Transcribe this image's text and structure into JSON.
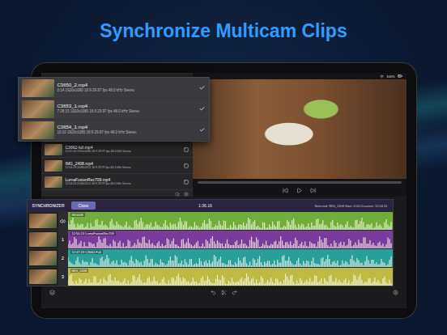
{
  "headline": "Synchronize Multicam Clips",
  "status_bar": {
    "battery": "100%"
  },
  "popup_clips": [
    {
      "name": "C3650_2.mp4",
      "meta": "0:14  1920x1080  16:9  29.97 fps  48.0 kHz  Stereo",
      "checked": true,
      "selected": true
    },
    {
      "name": "C3653_1.mp4",
      "meta": "7:28.15  1920x1080  16:9  29.97 fps  48.0 kHz  Stereo",
      "checked": true,
      "selected": true
    },
    {
      "name": "C3654_1.mp4",
      "meta": "10:10  1920x1080  16:9  29.97 fps  48.0 kHz  Stereo",
      "checked": true,
      "selected": true
    }
  ],
  "library_clips": [
    {
      "name": "C3662-full.mp4",
      "meta": "12:47.00  1920x1080  16:9  29.97 fps  48.0 kHz  Stereo",
      "checked": false,
      "selected": false
    },
    {
      "name": "IMG_2408.mp4",
      "meta": "12:04.28  2048x1152  16:9  29.97 fps  44.1 kHz  Stereo",
      "checked": false,
      "selected": false
    },
    {
      "name": "LumaFusionRec709.mp4",
      "meta": "12:04.03  2048x1152  16:9  29.97 fps  48.0 kHz  Stereo",
      "checked": false,
      "selected": false
    }
  ],
  "synchronizer": {
    "title": "SYNCHRONIZER",
    "close": "Close",
    "timecode": "1:36.16",
    "selection": "Selected: IMG_2408  Start: 0:00  Duration: 12:04.31",
    "tracks": [
      {
        "kind": "audio",
        "number": "",
        "label": "IMG038",
        "color": "#6fae3a"
      },
      {
        "kind": "video",
        "number": "1",
        "label": "12:50.13  LumaFusionRec709",
        "color": "#7a3c9c"
      },
      {
        "kind": "video",
        "number": "2",
        "label": "12:47.23  C3662-Full",
        "color": "#2a9e98"
      },
      {
        "kind": "video",
        "number": "3",
        "label": "IMG_2408",
        "color": "#bdbb45"
      }
    ]
  }
}
